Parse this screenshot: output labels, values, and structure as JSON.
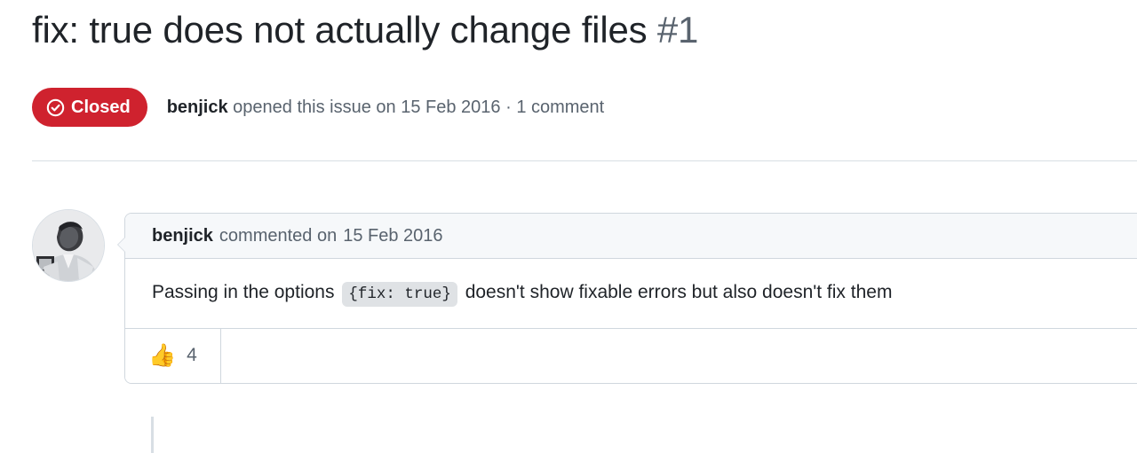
{
  "issue": {
    "title": "fix: true does not actually change files",
    "number": "#1",
    "state_badge": {
      "label": "Closed",
      "icon": "check-circle-icon",
      "color": "#cf222e"
    },
    "meta": {
      "author": "benjick",
      "action_text": " opened this issue on ",
      "date": "15 Feb 2016",
      "separator": " · ",
      "comment_count": "1 comment"
    }
  },
  "comment": {
    "avatar_alt": "benjick",
    "header": {
      "author": "benjick",
      "action": "commented on",
      "date": "15 Feb 2016"
    },
    "body": {
      "text_before": "Passing in the options",
      "code": "{fix: true}",
      "text_after": "doesn't show fixable errors but also doesn't fix them"
    },
    "reactions": [
      {
        "emoji": "👍",
        "name": "thumbs-up",
        "count": "4"
      }
    ]
  }
}
